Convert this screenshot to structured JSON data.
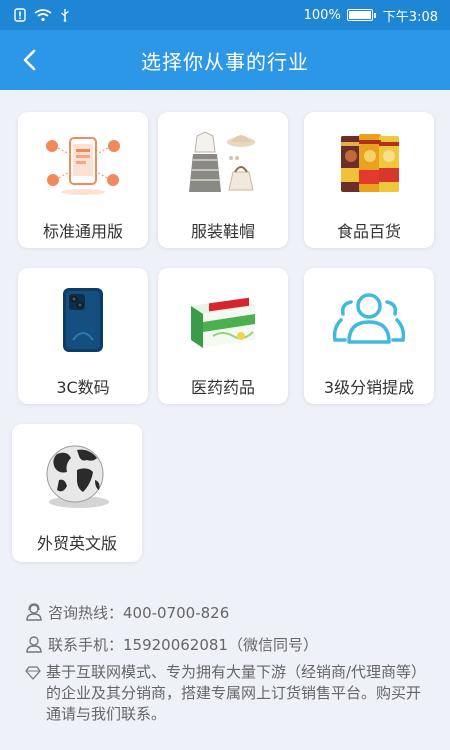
{
  "status_bar": {
    "battery": "100%",
    "time": "下午3:08"
  },
  "header": {
    "title": "选择你从事的行业"
  },
  "industries": [
    {
      "label": "标准通用版",
      "icon": "phone-network-icon"
    },
    {
      "label": "服装鞋帽",
      "icon": "clothing-icon"
    },
    {
      "label": "食品百货",
      "icon": "snacks-icon"
    },
    {
      "label": "3C数码",
      "icon": "smartphone-icon"
    },
    {
      "label": "医药药品",
      "icon": "medicine-box-icon"
    },
    {
      "label": "3级分销提成",
      "icon": "users-group-icon"
    },
    {
      "label": "外贸英文版",
      "icon": "globe-icon"
    }
  ],
  "contact": {
    "hotline": "咨询热线：400-0700-826",
    "mobile": "联系手机：15920062081（微信同号）",
    "description": "基于互联网模式、专为拥有大量下游（经销商/代理商等）的企业及其分销商，搭建专属网上订货销售平台。购买开通请与我们联系。"
  },
  "colors": {
    "header": "#2c97e6",
    "status_bar": "#1f86d6",
    "background": "#eef1f8",
    "accent_orange": "#f08a5d",
    "accent_blue": "#41b8e0"
  }
}
